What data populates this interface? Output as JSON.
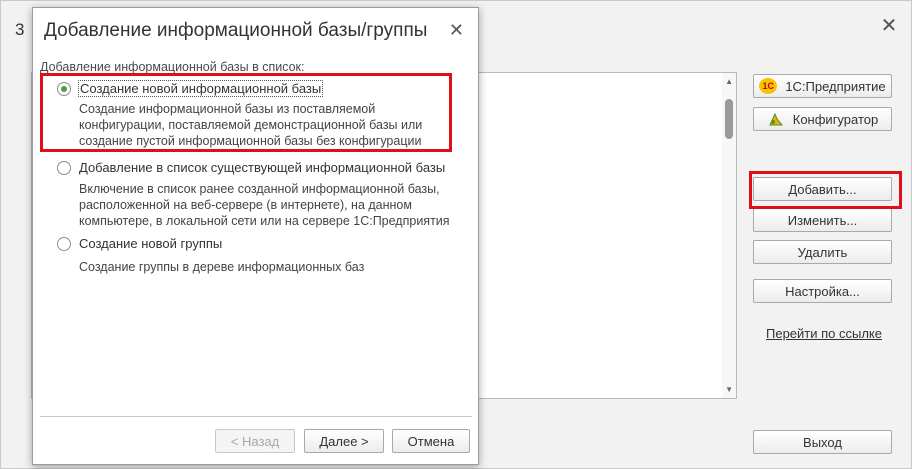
{
  "background": {
    "title_fragment": "3",
    "close_glyph": "✕",
    "buttons": {
      "enterprise": "1С:Предприятие",
      "configurator": "Конфигуратор",
      "add": "Добавить...",
      "edit": "Изменить...",
      "delete": "Удалить",
      "settings": "Настройка...",
      "exit": "Выход"
    },
    "link": "Перейти по ссылке"
  },
  "dialog": {
    "title": "Добавление информационной базы/группы",
    "close_glyph": "✕",
    "section_label": "Добавление информационной базы в список:",
    "options": [
      {
        "label": "Создание новой информационной базы",
        "description": "Создание информационной базы из поставляемой\nконфигурации, поставляемой демонстрационной базы или\nсоздание пустой информационной базы без конфигурации",
        "selected": true
      },
      {
        "label": "Добавление в список существующей информационной базы",
        "description": "Включение в список ранее созданной информационной базы,\nрасположенной на веб-сервере (в интернете), на данном\nкомпьютере,  в локальной сети или на сервере 1С:Предприятия",
        "selected": false
      },
      {
        "label": "Создание новой группы",
        "description": "Создание группы в дереве информационных баз",
        "selected": false
      }
    ],
    "buttons": {
      "back": "< Назад",
      "next": "Далее >",
      "cancel": "Отмена"
    }
  },
  "colors": {
    "highlight": "#e0101a",
    "radio_selected": "#4c9a4c"
  }
}
